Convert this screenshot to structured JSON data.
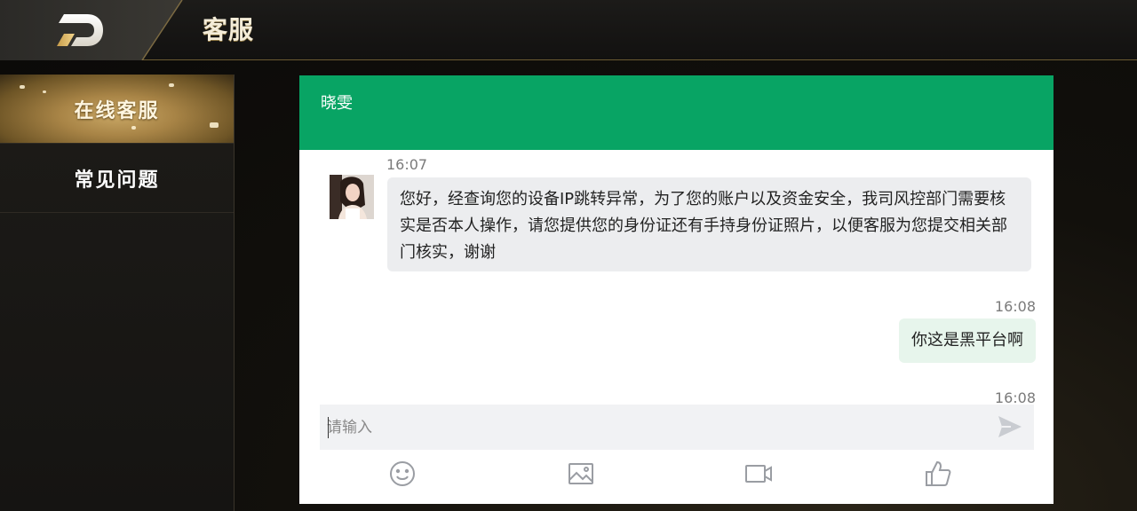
{
  "header": {
    "title": "客服",
    "back_icon": "back-logo-icon"
  },
  "sidebar": {
    "items": [
      {
        "label": "在线客服",
        "active": true
      },
      {
        "label": "常见问题",
        "active": false
      }
    ]
  },
  "chat": {
    "agent_name": "晓雯",
    "accent_color": "#08a464",
    "messages": [
      {
        "direction": "incoming",
        "time": "16:07",
        "text": "您好，经查询您的设备IP跳转异常，为了您的账户以及资金安全，我司风控部门需要核实是否本人操作，请您提供您的身份证还有手持身份证照片，以便客服为您提交相关部门核实，谢谢"
      },
      {
        "direction": "outgoing",
        "time": "16:08",
        "text": "你这是黑平台啊"
      }
    ],
    "partial_time": "16:08",
    "input": {
      "value": "",
      "placeholder": "请输入"
    },
    "toolbar_icons": [
      "emoji-icon",
      "image-icon",
      "video-icon",
      "thumbs-up-icon"
    ]
  }
}
